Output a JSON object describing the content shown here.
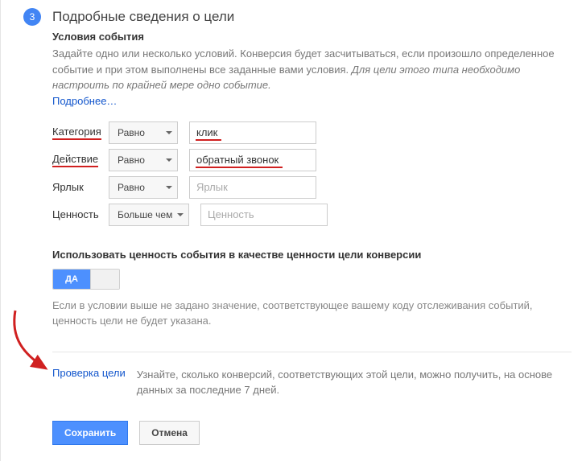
{
  "header": {
    "step_number": "3",
    "title": "Подробные сведения о цели"
  },
  "event": {
    "subtitle": "Условия события",
    "desc_plain": "Задайте одно или несколько условий. Конверсия будет засчитываться, если произошло определенное событие и при этом выполнены все заданные вами условия. ",
    "desc_italic": "Для цели этого типа необходимо настроить по крайней мере одно событие.",
    "more": "Подробнее…"
  },
  "rows": {
    "category": {
      "label": "Категория",
      "op": "Равно",
      "value": "клик"
    },
    "action": {
      "label": "Действие",
      "op": "Равно",
      "value": "обратный звонок"
    },
    "label": {
      "label": "Ярлык",
      "op": "Равно",
      "placeholder": "Ярлык"
    },
    "value": {
      "label": "Ценность",
      "op": "Больше чем",
      "placeholder": "Ценность"
    }
  },
  "useValue": {
    "title": "Использовать ценность события в качестве ценности цели конверсии",
    "on": "ДА",
    "note": "Если в условии выше не задано значение, соответствующее вашему коду отслеживания событий, ценность цели не будет указана."
  },
  "verify": {
    "label": "Проверка цели",
    "desc": "Узнайте, сколько конверсий, соответствующих этой цели, можно получить, на основе данных за последние 7 дней."
  },
  "buttons": {
    "save": "Сохранить",
    "cancel": "Отмена"
  }
}
